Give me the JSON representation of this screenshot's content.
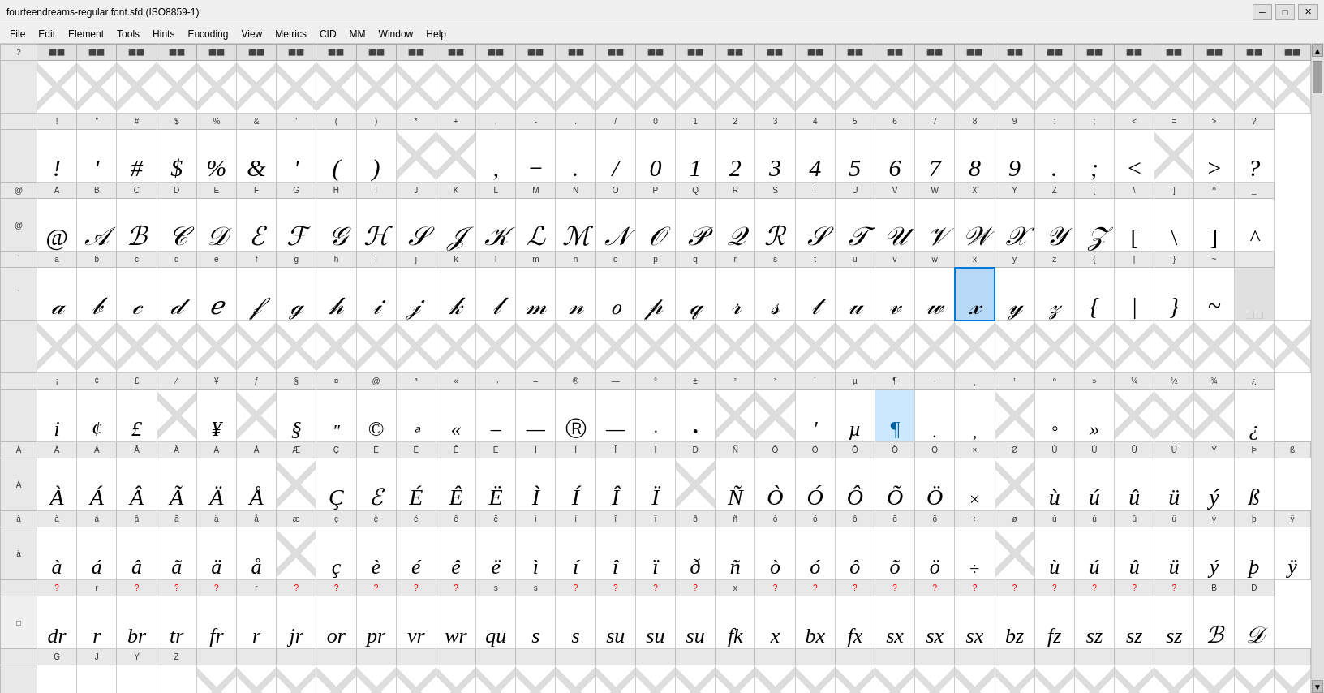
{
  "titlebar": {
    "title": "fourteendreams-regular font.sfd (ISO8859-1)",
    "minimize": "─",
    "maximize": "□",
    "close": "✕"
  },
  "menubar": {
    "items": [
      "File",
      "Edit",
      "Element",
      "Tools",
      "Hints",
      "Encoding",
      "View",
      "Metrics",
      "CID",
      "MM",
      "Window",
      "Help"
    ]
  },
  "grid": {
    "selected_cell": "x",
    "rows": [
      {
        "type": "icon-row",
        "label": "?",
        "cells": [
          "⬜",
          "⬜",
          "⬜",
          "⬜",
          "⬜",
          "⬜",
          "⬜",
          "⬜",
          "⬜",
          "⬜",
          "⬜",
          "⬜",
          "⬜",
          "⬜",
          "⬜",
          "⬜",
          "⬜",
          "⬜",
          "⬜",
          "⬜",
          "⬜",
          "⬜",
          "⬜",
          "⬜",
          "⬜",
          "⬜",
          "⬜",
          "⬜",
          "⬜",
          "⬜",
          "⬜"
        ]
      }
    ],
    "col_headers_ascii": [
      "!",
      "\"",
      "#",
      "$",
      "%",
      "&",
      "'",
      "(",
      ")",
      "*",
      "+",
      ",",
      "-",
      ".",
      "/",
      "0",
      "1",
      "2",
      "3",
      "4",
      "5",
      "6",
      "7",
      "8",
      "9",
      ":",
      ";",
      "<",
      "=",
      ">",
      "?"
    ],
    "col_headers_upper": [
      "@",
      "A",
      "B",
      "C",
      "D",
      "E",
      "F",
      "G",
      "H",
      "I",
      "J",
      "K",
      "L",
      "M",
      "N",
      "O",
      "P",
      "Q",
      "R",
      "S",
      "T",
      "U",
      "V",
      "W",
      "X",
      "Y",
      "Z",
      "[",
      "\\",
      "]",
      "^",
      "_"
    ],
    "col_headers_lower": [
      "`",
      "a",
      "b",
      "c",
      "d",
      "e",
      "f",
      "g",
      "h",
      "i",
      "j",
      "k",
      "l",
      "m",
      "n",
      "o",
      "p",
      "q",
      "r",
      "s",
      "t",
      "u",
      "v",
      "w",
      "x",
      "y",
      "z",
      "{",
      "|",
      "}",
      "~",
      ""
    ],
    "glyphs_row1": [
      "!",
      "'",
      "#",
      "$",
      "%",
      "&",
      "'",
      "(",
      ")",
      "*",
      "+",
      ",",
      "−",
      ".",
      "/",
      "0",
      "1",
      "2",
      "3",
      "4",
      "5",
      "6",
      "7",
      "8",
      "9",
      ":",
      ";",
      "<",
      "=",
      ">",
      "?"
    ],
    "glyphs_row2": [
      "@",
      "𝒜",
      "𝐵",
      "𝒞",
      "𝒟",
      "𝐸",
      "𝐹",
      "𝒢",
      "𝐻",
      "𝐼",
      "𝒥",
      "𝒦",
      "𝐿",
      "𝑀",
      "𝒩",
      "𝒪",
      "𝑃",
      "𝒬",
      "𝑅",
      "𝒮",
      "𝑇",
      "𝒰",
      "𝒱",
      "𝒲",
      "𝒳",
      "𝒴",
      "𝒵",
      "[",
      "\\",
      "]",
      "^"
    ],
    "glyphs_row3": [
      "`",
      "a",
      "b",
      "c",
      "d",
      "e",
      "f",
      "g",
      "h",
      "i",
      "j",
      "k",
      "l",
      "m",
      "n",
      "o",
      "p",
      "q",
      "r",
      "s",
      "t",
      "u",
      "v",
      "w",
      "x",
      "y",
      "z",
      "{",
      "|",
      "}",
      "~"
    ]
  }
}
